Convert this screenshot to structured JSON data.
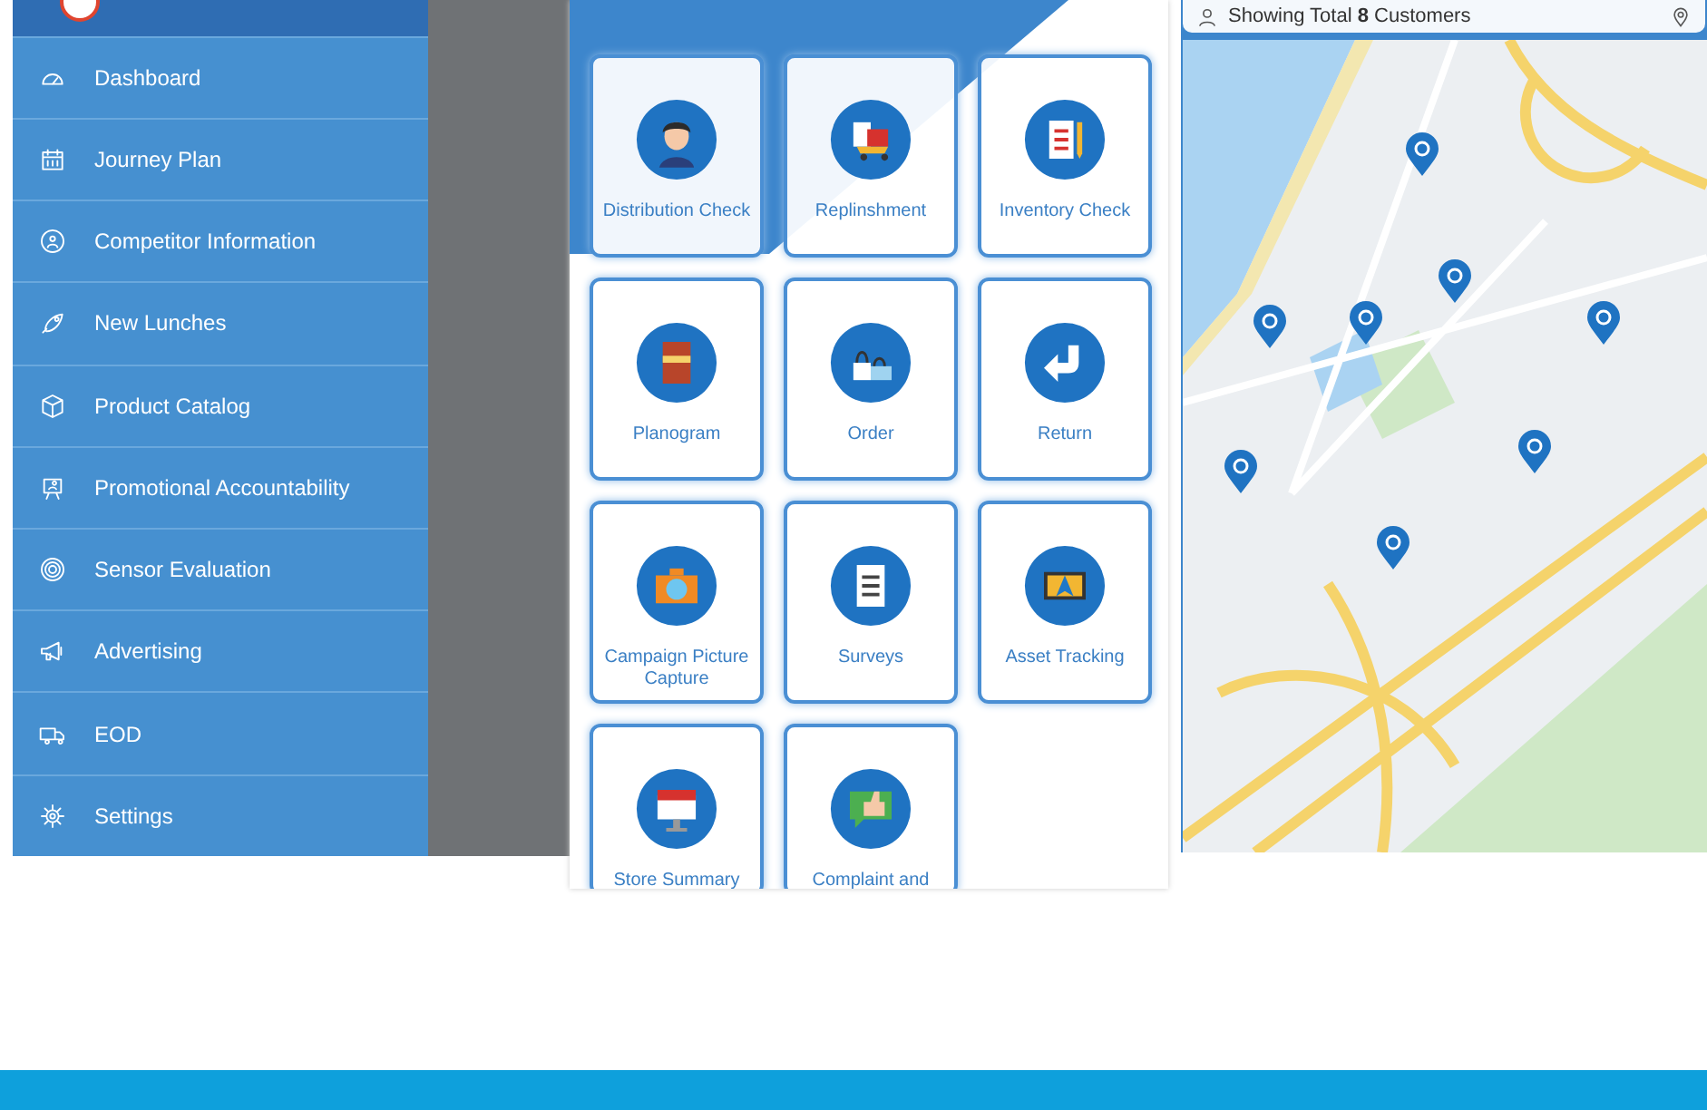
{
  "menu": {
    "items": [
      {
        "label": "Dashboard"
      },
      {
        "label": "Journey Plan"
      },
      {
        "label": "Competitor Information"
      },
      {
        "label": "New Lunches"
      },
      {
        "label": "Product Catalog"
      },
      {
        "label": "Promotional Accountability"
      },
      {
        "label": "Sensor Evaluation"
      },
      {
        "label": "Advertising"
      },
      {
        "label": "EOD"
      },
      {
        "label": "Settings"
      }
    ]
  },
  "dashboard": {
    "tiles": [
      {
        "label": "Distribution Check"
      },
      {
        "label": "Replinshment"
      },
      {
        "label": "Inventory Check"
      },
      {
        "label": "Planogram"
      },
      {
        "label": "Order"
      },
      {
        "label": "Return"
      },
      {
        "label": "Campaign Picture Capture"
      },
      {
        "label": "Surveys"
      },
      {
        "label": "Asset Tracking"
      },
      {
        "label": "Store Summary"
      },
      {
        "label": "Complaint and"
      }
    ]
  },
  "map_screen": {
    "search": {
      "value": "Showing Total **8** Customers"
    }
  }
}
